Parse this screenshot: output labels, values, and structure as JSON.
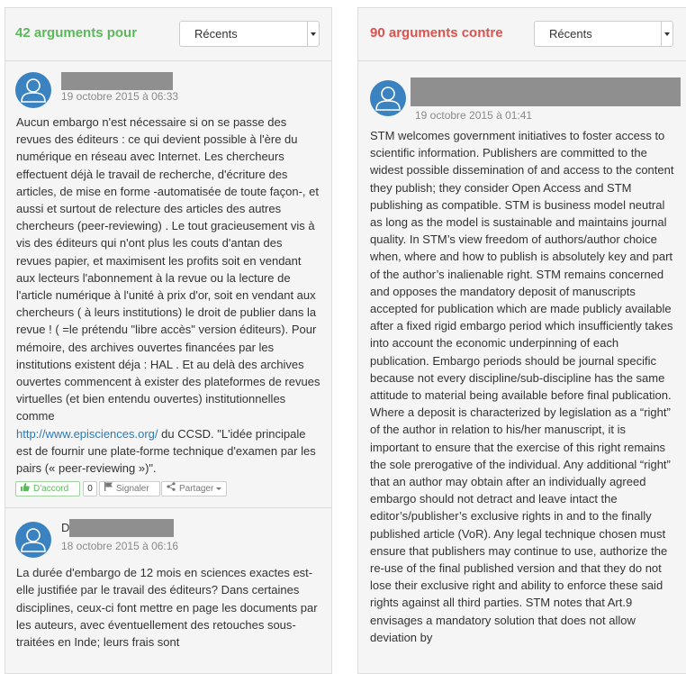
{
  "pour": {
    "title": "42 arguments pour",
    "sort": "Récents",
    "arguments": [
      {
        "date": "19 octobre 2015 à 06:33",
        "body_before_link": "Aucun embargo n'est nécessaire si on se passe des revues des éditeurs : ce qui devient possible à l'ère du numérique en réseau avec Internet. Les chercheurs effectuent déjà le travail de recherche, d'écriture des articles, de mise en forme -automatisée de toute façon-, et aussi et surtout de relecture des articles des autres chercheurs (peer-reviewing) . Le tout gracieusement vis à vis des éditeurs qui n'ont plus les couts d'antan des revues papier, et maximisent les profits soit en vendant aux lecteurs l'abonnement à la revue ou la lecture de l'article numérique à l'unité à prix d'or, soit en vendant aux chercheurs ( à leurs institutions) le droit de publier dans la revue ! ( =le prétendu \"libre accès\" version éditeurs). Pour mémoire, des archives ouvertes financées par les institutions existent déja : HAL . Et au delà des archives ouvertes commencent à exister des plateformes de revues virtuelles (et bien entendu ouvertes) institutionnelles comme",
        "link": "http://www.episciences.org/",
        "body_after_link": " du CCSD. \"L'idée principale est de fournir une plate-forme technique d'examen par les pairs (« peer-reviewing »)\".",
        "actions": {
          "agree": "D'accord",
          "count": "0",
          "report": "Signaler",
          "share": "Partager"
        }
      },
      {
        "name_initial": "D",
        "date": "18 octobre 2015 à 06:16",
        "body": "La durée d'embargo de 12 mois en sciences exactes est-elle justifiée par le travail des éditeurs? Dans certaines disciplines, ceux-ci font mettre en page les documents par les auteurs, avec éventuellement des retouches sous-traitées en Inde; leurs frais sont"
      }
    ]
  },
  "contre": {
    "title": "90 arguments contre",
    "sort": "Récents",
    "arguments": [
      {
        "date": "19 octobre 2015 à 01:41",
        "body": "STM welcomes government initiatives to foster access to scientific information. Publishers are committed to the widest possible dissemination of and access to the content they publish; they consider Open Access and STM publishing as compatible. STM is business model neutral as long as the model is sustainable and maintains journal quality. In STM’s view freedom of authors/author choice when, where and how to publish is absolutely key and part of the author’s inalienable right. STM remains concerned and opposes the mandatory deposit of manuscripts accepted for publication which are made publicly available after a fixed rigid embargo period which insufficiently takes into account the economic underpinning of each publication. Embargo periods should be journal specific because not every discipline/sub-discipline has the same attitude to material being available before final publication. Where a deposit is characterized by legislation as a “right” of the author in relation to his/her manuscript, it is important to ensure that the exercise of this right remains the sole prerogative of the individual. Any additional “right” that an author may obtain after an individually agreed embargo should not detract and leave intact the editor’s/publisher’s exclusive rights in and to the finally published article (VoR). Any legal technique chosen must ensure that publishers may continue to use, authorize the re-use of the final published version and that they do not lose their exclusive right and ability to enforce these said rights against all third parties. STM notes that Art.9 envisages a mandatory solution that does not allow deviation by"
      }
    ]
  }
}
